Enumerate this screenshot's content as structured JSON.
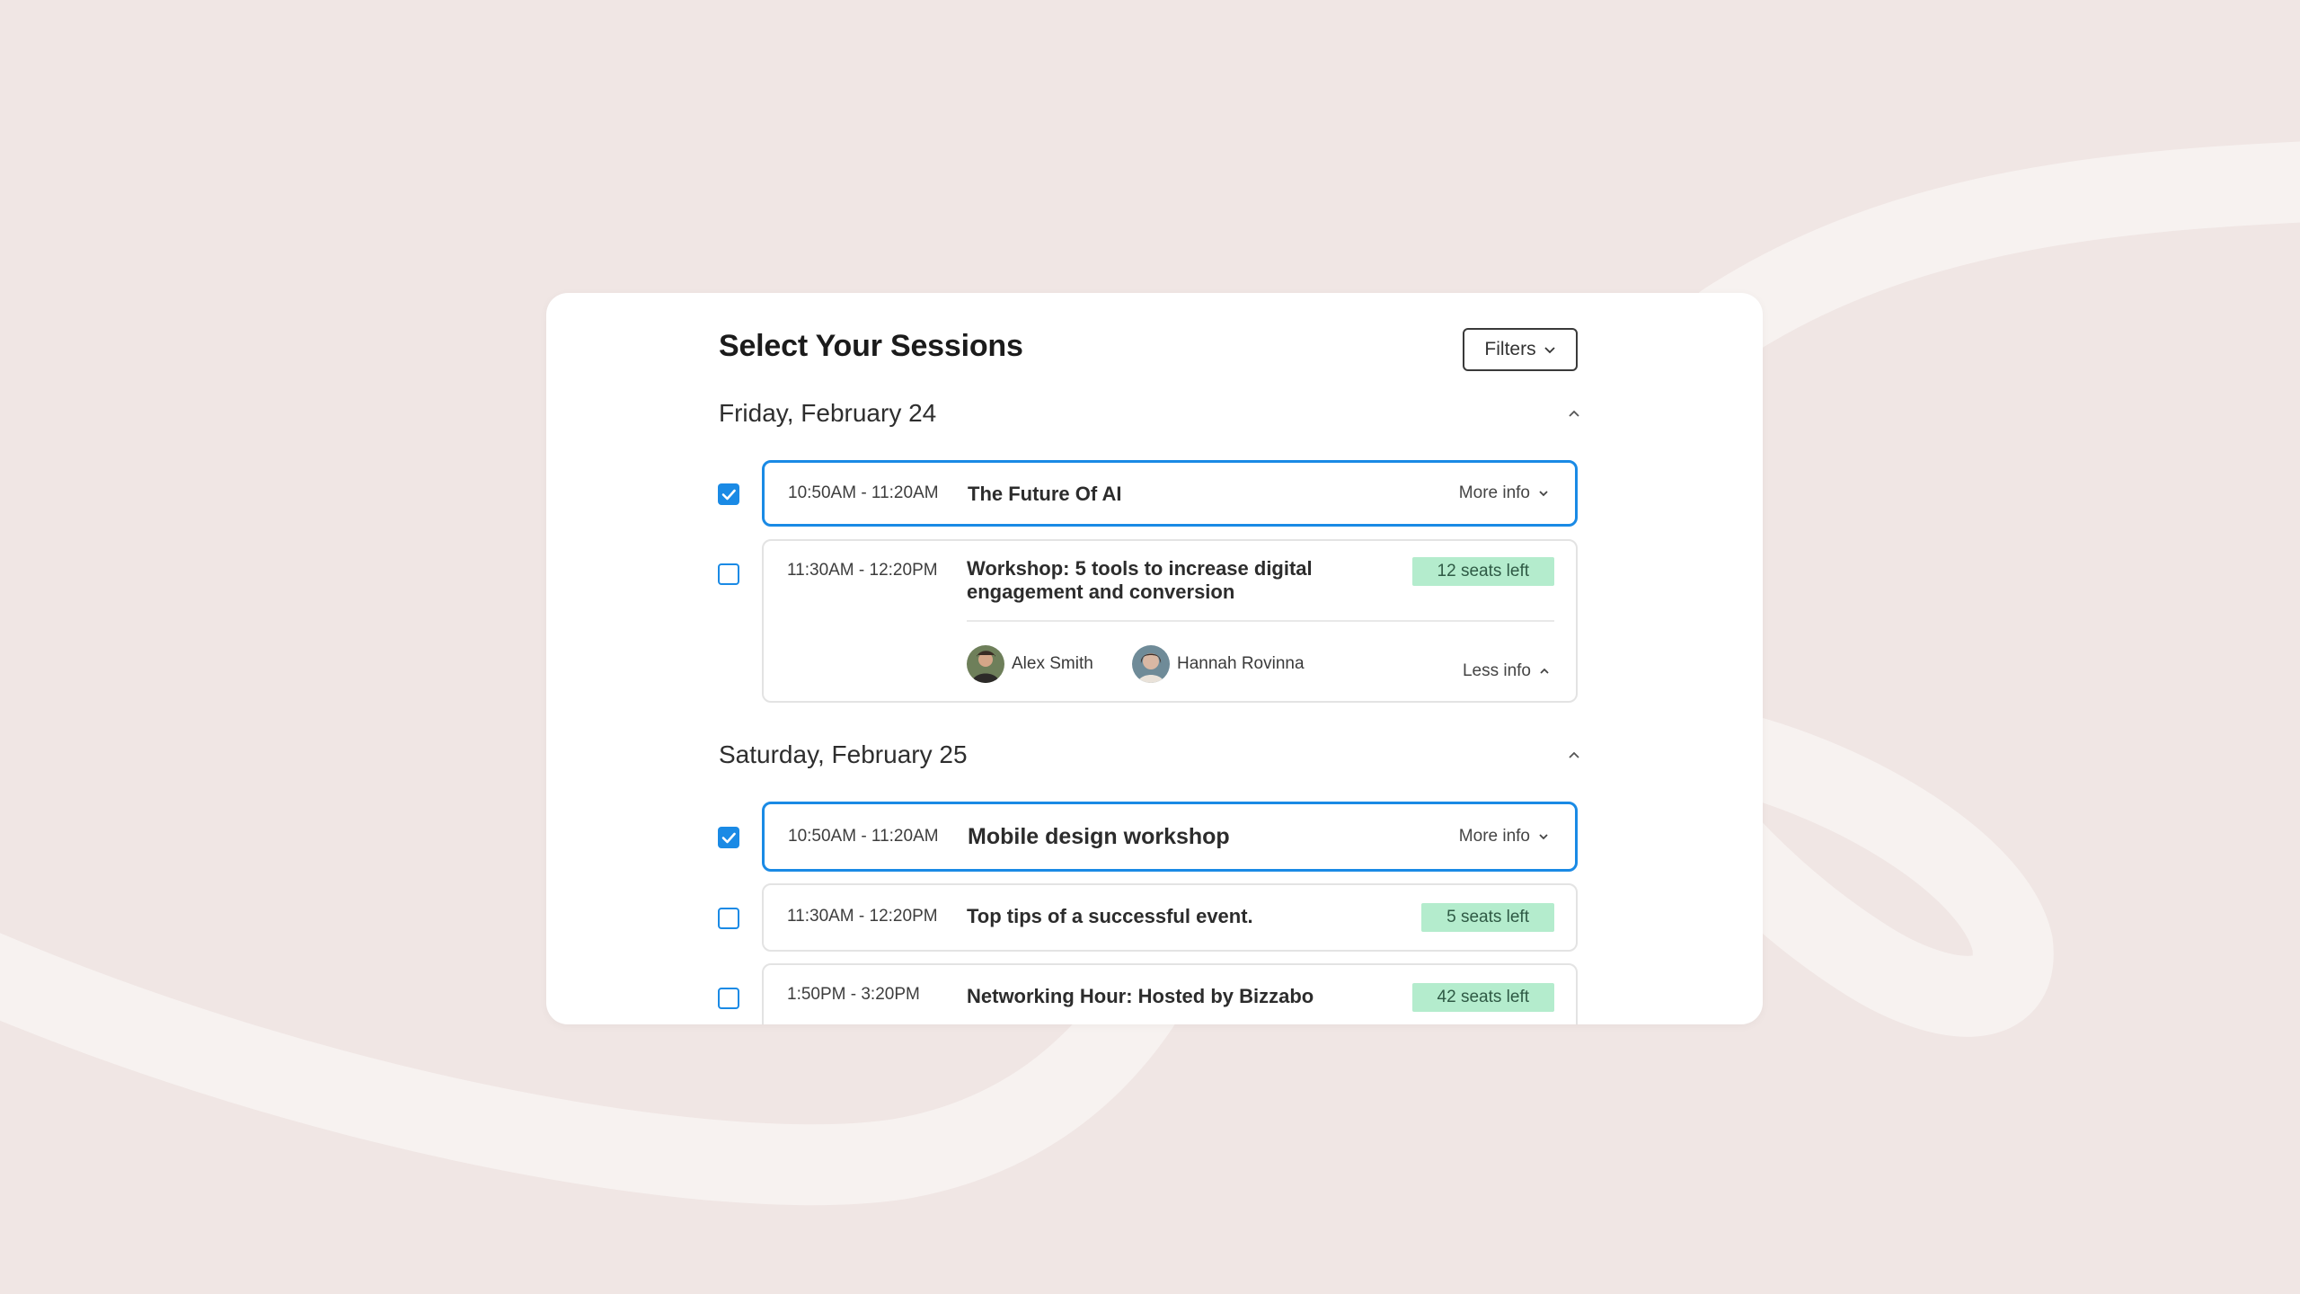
{
  "page": {
    "title": "Select Your Sessions",
    "filters_label": "Filters"
  },
  "colors": {
    "accent": "#1a8ae5",
    "seats_badge": "#b4eccd",
    "background": "#f0e6e4"
  },
  "days": [
    {
      "label": "Friday, February 24",
      "sessions": [
        {
          "time": "10:50AM - 11:20AM",
          "title": "The Future Of AI",
          "selected": true,
          "info_label": "More info"
        },
        {
          "time": "11:30AM - 12:20PM",
          "title": "Workshop: 5 tools to increase digital engagement and conversion",
          "selected": false,
          "seats": "12 seats left",
          "info_label": "Less info",
          "speakers": [
            "Alex Smith",
            "Hannah Rovinna"
          ]
        }
      ]
    },
    {
      "label": "Saturday, February 25",
      "sessions": [
        {
          "time": "10:50AM - 11:20AM",
          "title": "Mobile design workshop",
          "selected": true,
          "info_label": "More info"
        },
        {
          "time": "11:30AM - 12:20PM",
          "title": "Top tips of a successful event.",
          "selected": false,
          "seats": "5 seats left"
        },
        {
          "time": "1:50PM - 3:20PM",
          "title": "Networking Hour: Hosted by Bizzabo",
          "selected": false,
          "seats": "42 seats left"
        }
      ]
    }
  ]
}
